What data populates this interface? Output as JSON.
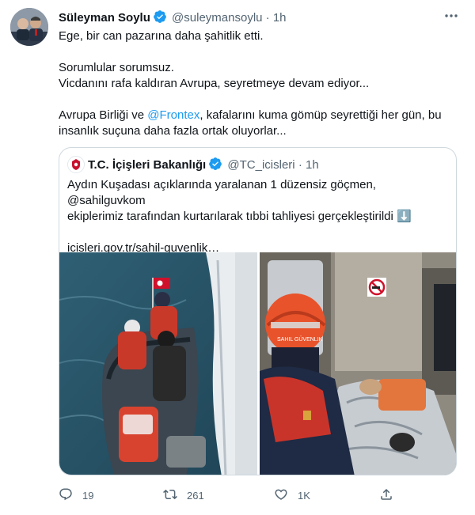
{
  "author": {
    "name": "Süleyman Soylu",
    "handle": "@suleymansoylu",
    "separator": "·",
    "time": "1h",
    "verified": true
  },
  "tweet_paragraphs": {
    "p1": "Ege, bir can pazarına daha şahitlik etti.",
    "p2_line1": "Sorumlular sorumsuz.",
    "p2_line2": "Vicdanını rafa kaldıran Avrupa, seyretmeye devam ediyor...",
    "p3_before": "Avrupa Birliği ve ",
    "p3_mention": "@Frontex",
    "p3_after": ", kafalarını kuma gömüp seyrettiği her gün, bu insanlık suçuna daha fazla ortak oluyorlar..."
  },
  "quoted": {
    "name": "T.C. İçişleri Bakanlığı",
    "handle": "@TC_icisleri",
    "separator": "·",
    "time": "1h",
    "text_line1": "Aydın Kuşadası açıklarında yaralanan 1 düzensiz göçmen, @sahilguvkom",
    "text_line2": "ekiplerimiz tarafından kurtarılarak tıbbi tahliyesi gerçekleştirildi ⬇️",
    "link": "icisleri.gov.tr/sahil-guvenlik…",
    "photo_text": "SAHIL GÜVENLIK"
  },
  "actions": {
    "replies": "19",
    "retweets": "261",
    "likes": "1K"
  },
  "colors": {
    "accent": "#1d9bf0",
    "muted": "#536471",
    "border": "#cfd9de"
  },
  "icons": [
    "more-icon",
    "verified-badge-icon",
    "reply-icon",
    "retweet-icon",
    "like-icon",
    "share-icon"
  ]
}
